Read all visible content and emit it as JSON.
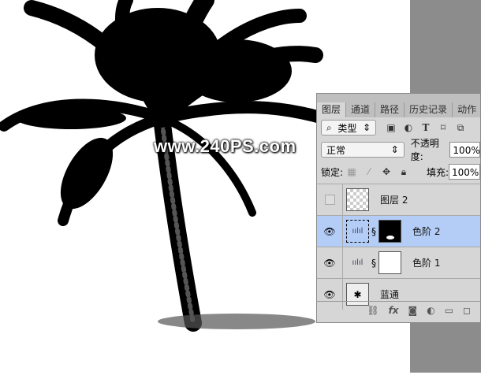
{
  "watermark": "www.240PS.com",
  "tabs": [
    "图层",
    "通道",
    "路径",
    "历史记录",
    "动作"
  ],
  "filter": {
    "label": "类型",
    "icons": [
      "image-filter-icon",
      "adjustment-filter-icon",
      "type-filter-icon",
      "shape-filter-icon",
      "smart-object-filter-icon"
    ]
  },
  "blend": {
    "mode": "正常",
    "opacity_label": "不透明度:",
    "opacity": "100%"
  },
  "lock": {
    "label": "锁定:",
    "fill_label": "填充:",
    "fill": "100%"
  },
  "layers": [
    {
      "name": "图层 2",
      "visible": false,
      "selected": false
    },
    {
      "name": "色阶 2",
      "visible": true,
      "selected": true
    },
    {
      "name": "色阶 1",
      "visible": true,
      "selected": false
    },
    {
      "name": "蓝通",
      "visible": true,
      "selected": false
    }
  ],
  "colors": {
    "selected": "#b4cdf6",
    "panel": "#d6d6d6",
    "workspace": "#8c8c8c"
  }
}
